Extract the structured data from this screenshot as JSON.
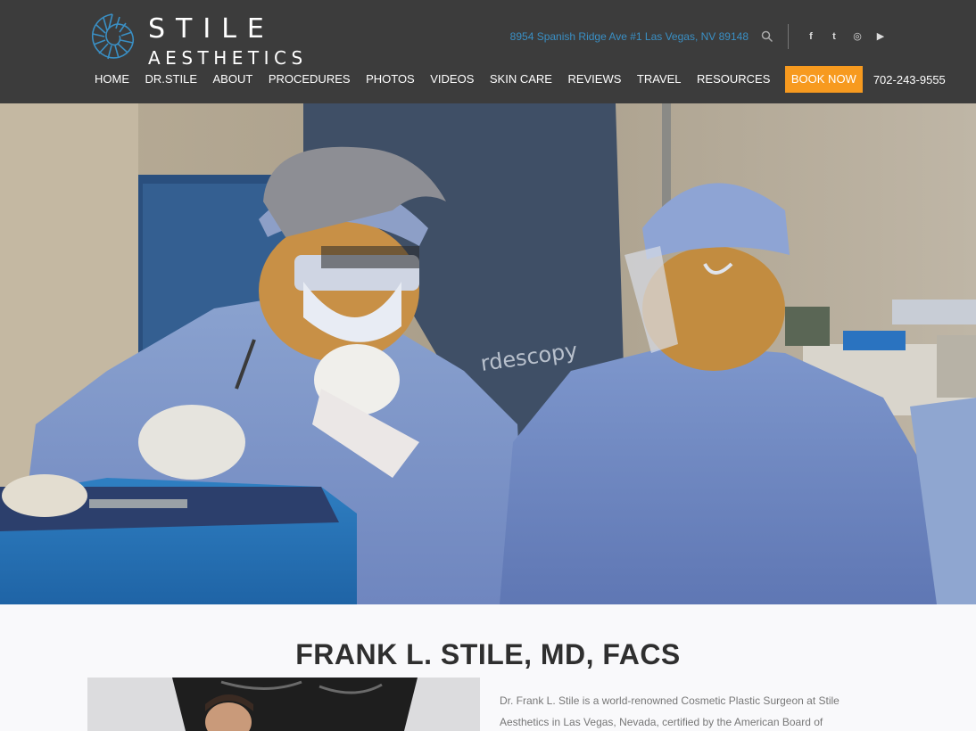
{
  "brand": {
    "line1": "STILE",
    "line2": "AESTHETICS",
    "icon": "nautilus-shell-logo",
    "accent_color": "#3a8fc4"
  },
  "topbar": {
    "address": "8954 Spanish Ridge Ave #1 Las Vegas, NV 89148",
    "search_icon": "search-icon",
    "social": [
      {
        "name": "facebook-icon",
        "glyph": "f"
      },
      {
        "name": "twitter-icon",
        "glyph": "t"
      },
      {
        "name": "instagram-icon",
        "glyph": "◎"
      },
      {
        "name": "youtube-icon",
        "glyph": "▶"
      }
    ]
  },
  "nav": {
    "items": [
      "HOME",
      "DR.STILE",
      "ABOUT",
      "PROCEDURES",
      "PHOTOS",
      "VIDEOS",
      "SKIN CARE",
      "REVIEWS",
      "TRAVEL",
      "RESOURCES"
    ],
    "book_label": "BOOK NOW",
    "book_color": "#f79a1f",
    "phone": "702-243-9555"
  },
  "hero": {
    "drape_text": "rdescopy"
  },
  "about": {
    "title": "FRANK L. STILE, MD, FACS",
    "text_line1": "Dr. Frank L. Stile is a world-renowned Cosmetic Plastic Surgeon at Stile",
    "text_line2": "Aesthetics in Las Vegas, Nevada, certified by the American Board of"
  }
}
